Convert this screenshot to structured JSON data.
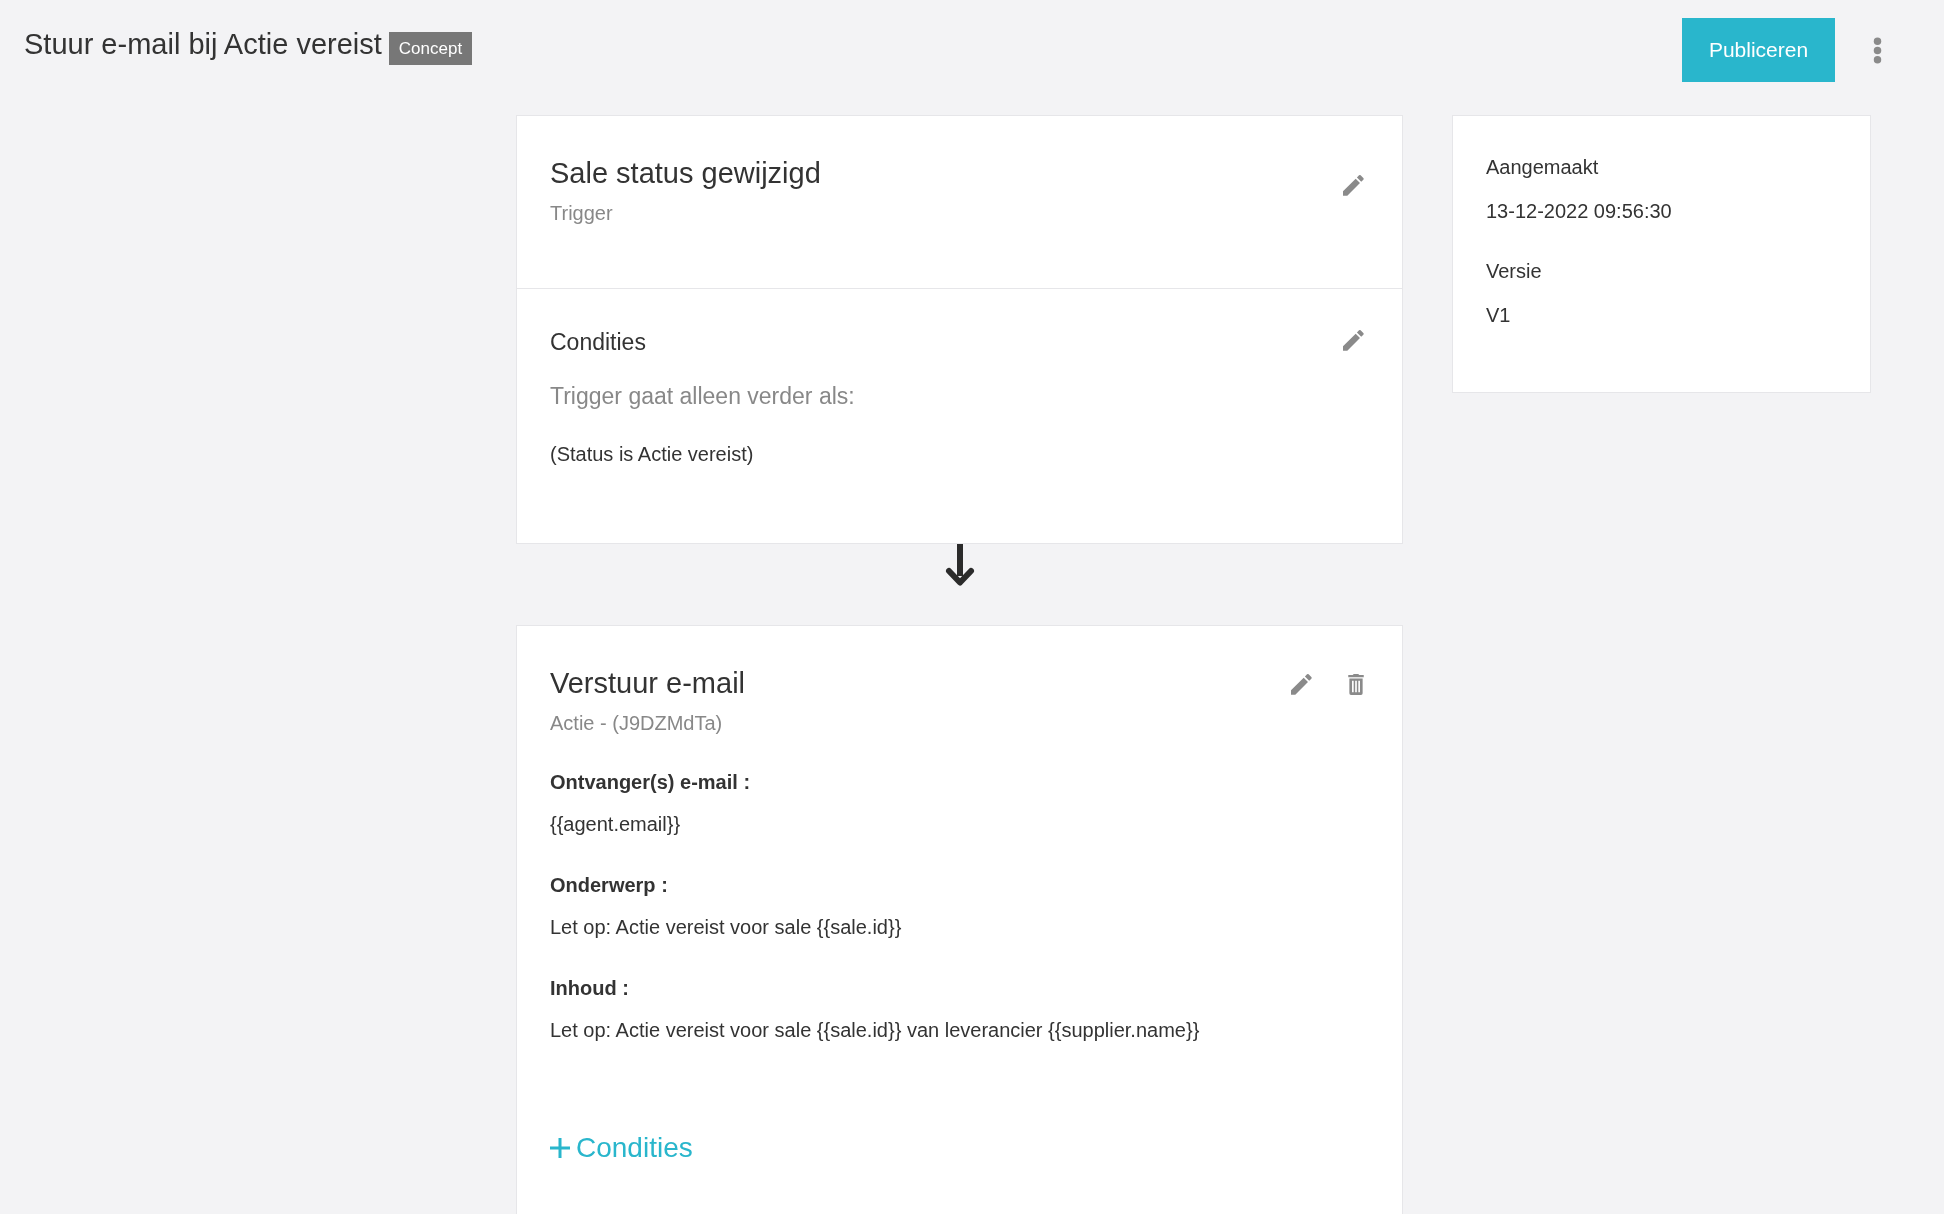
{
  "header": {
    "title": "Stuur e-mail bij Actie vereist",
    "status_badge": "Concept",
    "publish_button": "Publiceren"
  },
  "trigger": {
    "title": "Sale status gewijzigd",
    "subtitle": "Trigger",
    "conditions": {
      "heading": "Condities",
      "intro": "Trigger gaat alleen verder als:",
      "rule": "(Status is Actie vereist)"
    }
  },
  "action": {
    "title": "Verstuur e-mail",
    "subtitle": "Actie - (J9DZMdTa)",
    "fields": [
      {
        "label": "Ontvanger(s) e-mail :",
        "value": "{{agent.email}}"
      },
      {
        "label": "Onderwerp :",
        "value": "Let op: Actie vereist voor sale {{sale.id}}"
      },
      {
        "label": "Inhoud :",
        "value": "Let op: Actie vereist voor sale {{sale.id}} van leverancier {{supplier.name}}"
      }
    ],
    "add_conditions_link": "Condities"
  },
  "info": {
    "items": [
      {
        "label": "Aangemaakt",
        "value": "13-12-2022 09:56:30"
      },
      {
        "label": "Versie",
        "value": "V1"
      }
    ]
  }
}
